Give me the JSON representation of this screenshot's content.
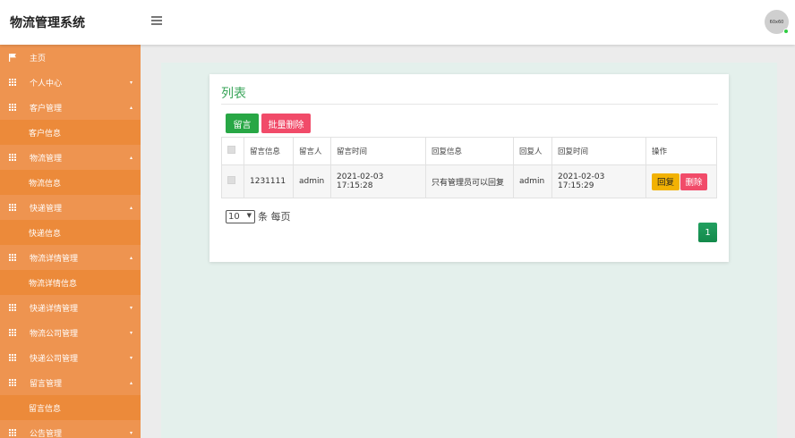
{
  "app": {
    "title": "物流管理系统",
    "avatar_text": "60x60"
  },
  "sidebar": {
    "items": [
      {
        "label": "主页",
        "icon": "flag-icon",
        "type": "top"
      },
      {
        "label": "个人中心",
        "icon": "grid-icon",
        "type": "group",
        "caret": "▾"
      },
      {
        "label": "客户管理",
        "icon": "grid-icon",
        "type": "group",
        "caret": "▴"
      },
      {
        "label": "客户信息",
        "type": "sub"
      },
      {
        "label": "物流管理",
        "icon": "grid-icon",
        "type": "group",
        "caret": "▴"
      },
      {
        "label": "物流信息",
        "type": "sub"
      },
      {
        "label": "快递管理",
        "icon": "grid-icon",
        "type": "group",
        "caret": "▴"
      },
      {
        "label": "快递信息",
        "type": "sub"
      },
      {
        "label": "物流详情管理",
        "icon": "grid-icon",
        "type": "group",
        "caret": "▴"
      },
      {
        "label": "物流详情信息",
        "type": "sub"
      },
      {
        "label": "快递详情管理",
        "icon": "grid-icon",
        "type": "group",
        "caret": "▾"
      },
      {
        "label": "物流公司管理",
        "icon": "grid-icon",
        "type": "group",
        "caret": "▾"
      },
      {
        "label": "快递公司管理",
        "icon": "grid-icon",
        "type": "group",
        "caret": "▾"
      },
      {
        "label": "留言管理",
        "icon": "grid-icon",
        "type": "group",
        "caret": "▴"
      },
      {
        "label": "留言信息",
        "type": "sub"
      },
      {
        "label": "公告管理",
        "icon": "grid-icon",
        "type": "group",
        "caret": "▾"
      }
    ]
  },
  "card": {
    "title": "列表",
    "add_label": "留言",
    "bulk_delete_label": "批量删除"
  },
  "table": {
    "headers": [
      "留言信息",
      "留言人",
      "留言时间",
      "回复信息",
      "回复人",
      "回复时间",
      "操作"
    ],
    "rows": [
      {
        "message": "1231111",
        "author": "admin",
        "time": "2021-02-03 17:15:28",
        "reply": "只有管理员可以回复",
        "replier": "admin",
        "reply_time": "2021-02-03 17:15:29",
        "reply_btn": "回复",
        "delete_btn": "删除"
      }
    ]
  },
  "pagination": {
    "page_size": "10",
    "page_size_suffix": "条 每页",
    "current_page": "1"
  },
  "colors": {
    "sidebar": "#ec8a3a",
    "accent_green": "#28a745",
    "danger": "#f14b69",
    "warning": "#f2b203",
    "content_bg": "#e4f0ec"
  }
}
